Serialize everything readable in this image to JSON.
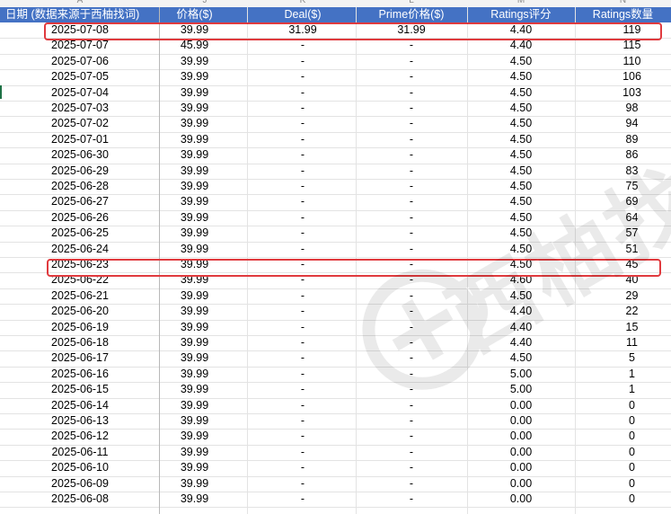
{
  "column_letters": [
    "A",
    "J",
    "K",
    "L",
    "M",
    "N"
  ],
  "headers": {
    "date": "日期 (数据来源于西柚找词)",
    "price": "价格($)",
    "deal": "Deal($)",
    "prime": "Prime价格($)",
    "ratings_score": "Ratings评分",
    "ratings_count": "Ratings数量"
  },
  "rows": [
    {
      "date": "2025-07-08",
      "price": "39.99",
      "deal": "31.99",
      "prime": "31.99",
      "score": "4.40",
      "count": "119"
    },
    {
      "date": "2025-07-07",
      "price": "45.99",
      "deal": "-",
      "prime": "-",
      "score": "4.40",
      "count": "115"
    },
    {
      "date": "2025-07-06",
      "price": "39.99",
      "deal": "-",
      "prime": "-",
      "score": "4.50",
      "count": "110"
    },
    {
      "date": "2025-07-05",
      "price": "39.99",
      "deal": "-",
      "prime": "-",
      "score": "4.50",
      "count": "106"
    },
    {
      "date": "2025-07-04",
      "price": "39.99",
      "deal": "-",
      "prime": "-",
      "score": "4.50",
      "count": "103"
    },
    {
      "date": "2025-07-03",
      "price": "39.99",
      "deal": "-",
      "prime": "-",
      "score": "4.50",
      "count": "98"
    },
    {
      "date": "2025-07-02",
      "price": "39.99",
      "deal": "-",
      "prime": "-",
      "score": "4.50",
      "count": "94"
    },
    {
      "date": "2025-07-01",
      "price": "39.99",
      "deal": "-",
      "prime": "-",
      "score": "4.50",
      "count": "89"
    },
    {
      "date": "2025-06-30",
      "price": "39.99",
      "deal": "-",
      "prime": "-",
      "score": "4.50",
      "count": "86"
    },
    {
      "date": "2025-06-29",
      "price": "39.99",
      "deal": "-",
      "prime": "-",
      "score": "4.50",
      "count": "83"
    },
    {
      "date": "2025-06-28",
      "price": "39.99",
      "deal": "-",
      "prime": "-",
      "score": "4.50",
      "count": "75"
    },
    {
      "date": "2025-06-27",
      "price": "39.99",
      "deal": "-",
      "prime": "-",
      "score": "4.50",
      "count": "69"
    },
    {
      "date": "2025-06-26",
      "price": "39.99",
      "deal": "-",
      "prime": "-",
      "score": "4.50",
      "count": "64"
    },
    {
      "date": "2025-06-25",
      "price": "39.99",
      "deal": "-",
      "prime": "-",
      "score": "4.50",
      "count": "57"
    },
    {
      "date": "2025-06-24",
      "price": "39.99",
      "deal": "-",
      "prime": "-",
      "score": "4.50",
      "count": "51"
    },
    {
      "date": "2025-06-23",
      "price": "39.99",
      "deal": "-",
      "prime": "-",
      "score": "4.50",
      "count": "45"
    },
    {
      "date": "2025-06-22",
      "price": "39.99",
      "deal": "-",
      "prime": "-",
      "score": "4.60",
      "count": "40"
    },
    {
      "date": "2025-06-21",
      "price": "39.99",
      "deal": "-",
      "prime": "-",
      "score": "4.50",
      "count": "29"
    },
    {
      "date": "2025-06-20",
      "price": "39.99",
      "deal": "-",
      "prime": "-",
      "score": "4.40",
      "count": "22"
    },
    {
      "date": "2025-06-19",
      "price": "39.99",
      "deal": "-",
      "prime": "-",
      "score": "4.40",
      "count": "15"
    },
    {
      "date": "2025-06-18",
      "price": "39.99",
      "deal": "-",
      "prime": "-",
      "score": "4.40",
      "count": "11"
    },
    {
      "date": "2025-06-17",
      "price": "39.99",
      "deal": "-",
      "prime": "-",
      "score": "4.50",
      "count": "5"
    },
    {
      "date": "2025-06-16",
      "price": "39.99",
      "deal": "-",
      "prime": "-",
      "score": "5.00",
      "count": "1"
    },
    {
      "date": "2025-06-15",
      "price": "39.99",
      "deal": "-",
      "prime": "-",
      "score": "5.00",
      "count": "1"
    },
    {
      "date": "2025-06-14",
      "price": "39.99",
      "deal": "-",
      "prime": "-",
      "score": "0.00",
      "count": "0"
    },
    {
      "date": "2025-06-13",
      "price": "39.99",
      "deal": "-",
      "prime": "-",
      "score": "0.00",
      "count": "0"
    },
    {
      "date": "2025-06-12",
      "price": "39.99",
      "deal": "-",
      "prime": "-",
      "score": "0.00",
      "count": "0"
    },
    {
      "date": "2025-06-11",
      "price": "39.99",
      "deal": "-",
      "prime": "-",
      "score": "0.00",
      "count": "0"
    },
    {
      "date": "2025-06-10",
      "price": "39.99",
      "deal": "-",
      "prime": "-",
      "score": "0.00",
      "count": "0"
    },
    {
      "date": "2025-06-09",
      "price": "39.99",
      "deal": "-",
      "prime": "-",
      "score": "0.00",
      "count": "0"
    },
    {
      "date": "2025-06-08",
      "price": "39.99",
      "deal": "-",
      "prime": "-",
      "score": "0.00",
      "count": "0"
    }
  ],
  "highlighted_rows": [
    0,
    15
  ],
  "watermark": "西柚找",
  "colors": {
    "header_bg": "#4472c4",
    "highlight": "#e03a3e",
    "grid": "#e3e3e3"
  }
}
